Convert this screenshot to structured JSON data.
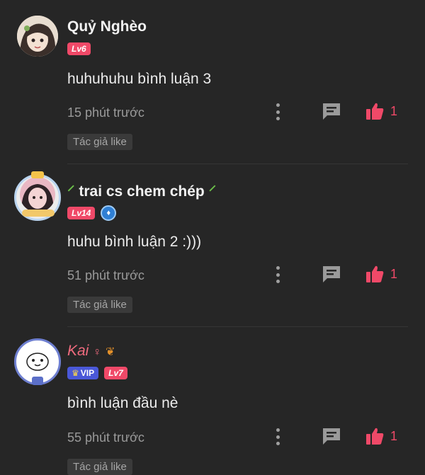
{
  "comments": [
    {
      "name": "Quỷ Nghèo",
      "level": "Lv6",
      "vip": "",
      "text": "huhuhuhu bình luận 3",
      "time": "15 phút trước",
      "likes": "1",
      "author_tag": "Tác giả like"
    },
    {
      "name": "trai cs chem chép",
      "level": "Lv14",
      "vip": "",
      "text": "huhu bình luận 2 :)))",
      "time": "51 phút trước",
      "likes": "1",
      "author_tag": "Tác giả like"
    },
    {
      "name": "Kai",
      "level": "Lv7",
      "vip": "VIP",
      "text": "bình luận đầu nè",
      "time": "55 phút trước",
      "likes": "1",
      "author_tag": "Tác giả like"
    }
  ],
  "icons": {
    "more": "more-vertical-icon",
    "reply": "comment-bubble-icon",
    "like": "thumbs-up-icon",
    "sprout": "sprout-emoji-icon",
    "crown": "crown-icon"
  },
  "colors": {
    "background": "#262626",
    "accent": "#f04968",
    "vip": "#4a58d8",
    "kai_name": "#f06b7e"
  }
}
